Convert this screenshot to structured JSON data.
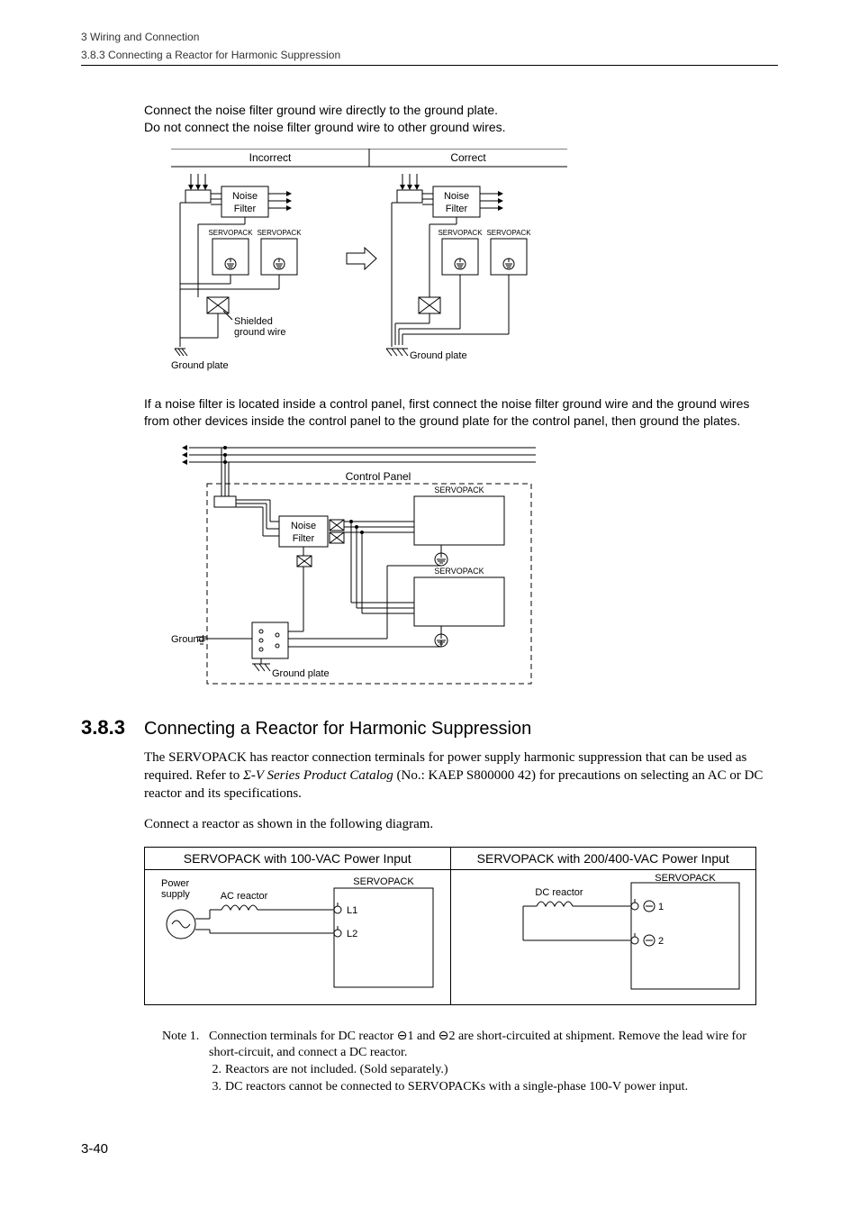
{
  "header": {
    "chapter": "3  Wiring and Connection",
    "section": "3.8.3  Connecting a Reactor for Harmonic Suppression"
  },
  "para1_l1": "Connect the noise filter ground wire directly to the ground plate.",
  "para1_l2": "Do not connect the noise filter ground wire to other ground wires.",
  "diag1": {
    "incorrect": "Incorrect",
    "correct": "Correct",
    "noise_filter": "Noise",
    "noise_filter2": "Filter",
    "servopack": "SERVOPACK",
    "shielded1": "Shielded",
    "shielded2": "ground wire",
    "ground_plate": "Ground plate"
  },
  "para2": "If a noise filter is located inside a control panel, first connect the noise filter ground wire and the ground wires from other devices inside the control panel to the ground plate for the control panel, then ground the plates.",
  "diag2": {
    "control_panel": "Control Panel",
    "noise_filter": "Noise",
    "noise_filter2": "Filter",
    "servopack": "SERVOPACK",
    "ground": "Ground",
    "ground_plate": "Ground plate"
  },
  "sec": {
    "num": "3.8.3",
    "title": "Connecting a Reactor for Harmonic Suppression"
  },
  "para3a": "The SERVOPACK has reactor connection terminals for power supply harmonic suppression that can be used as required. Refer to ",
  "para3b": "Σ-V Series Product Catalog",
  "para3c": " (No.: KAEP S800000 42) for precautions on selecting an AC or DC reactor and its specifications.",
  "para4": "Connect a reactor as shown in the following diagram.",
  "reactor": {
    "h1": "SERVOPACK with 100-VAC Power Input",
    "h2": "SERVOPACK with 200/400-VAC Power Input",
    "power": "Power",
    "supply": "supply",
    "ac_reactor": "AC reactor",
    "dc_reactor": "DC reactor",
    "servopack": "SERVOPACK",
    "l1": "L1",
    "l2": "L2",
    "t1": "1",
    "t2": "2"
  },
  "notes": {
    "label": "Note 1.",
    "n1": "Connection terminals for DC reactor  ⊖1 and  ⊖2 are short-circuited at shipment. Remove the lead wire for short-circuit, and connect a DC reactor.",
    "n2l": "2.",
    "n2": "Reactors are not included. (Sold separately.)",
    "n3l": "3.",
    "n3": "DC reactors cannot be connected to SERVOPACKs with a single-phase 100-V power input."
  },
  "page_num": "3-40"
}
